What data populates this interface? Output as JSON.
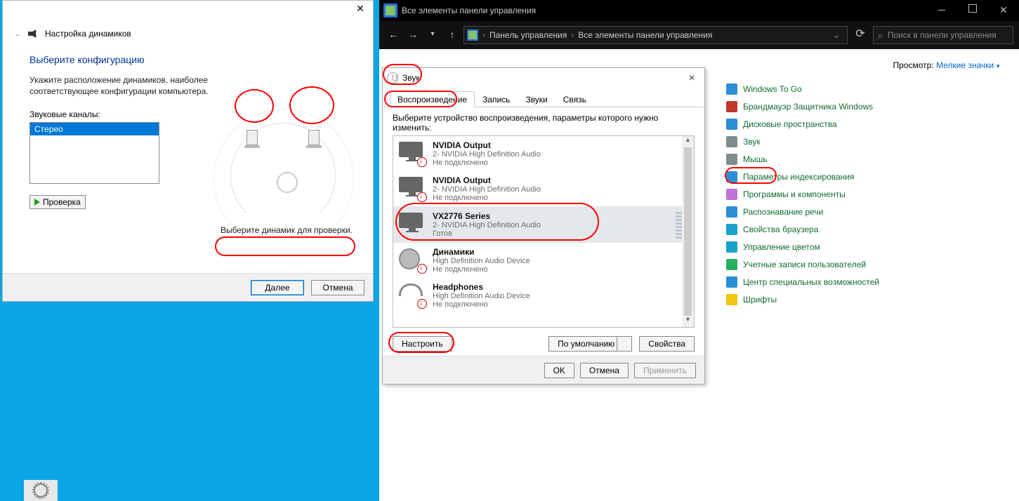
{
  "wizard": {
    "header": "Настройка динамиков",
    "title": "Выберите конфигурацию",
    "desc": "Укажите расположение динамиков, наиболее соответствующее конфигурации компьютера.",
    "channels_label": "Звуковые каналы:",
    "channels": [
      "Стерео"
    ],
    "test_btn": "Проверка",
    "hint": "Выберите динамик для проверки.",
    "next": "Далее",
    "cancel": "Отмена"
  },
  "cp": {
    "titlebar": "Все элементы панели управления",
    "crumb1": "Панель управления",
    "crumb2": "Все элементы панели управления",
    "search_placeholder": "Поиск в панели управления",
    "view_label": "Просмотр:",
    "view_value": "Мелкие значки",
    "items": [
      {
        "label": "Windows To Go",
        "color": "#2a8fd6"
      },
      {
        "label": "Брандмауэр Защитника Windows",
        "color": "#c0392b"
      },
      {
        "label": "Дисковые пространства",
        "color": "#2a8fd6"
      },
      {
        "label": "Звук",
        "color": "#7f8c8d"
      },
      {
        "label": "Мышь",
        "color": "#7f8c8d"
      },
      {
        "label": "Параметры индексирования",
        "color": "#2a8fd6"
      },
      {
        "label": "Программы и компоненты",
        "color": "#c074d4"
      },
      {
        "label": "Распознавание речи",
        "color": "#2a8fd6"
      },
      {
        "label": "Свойства браузера",
        "color": "#1aa3c8"
      },
      {
        "label": "Управление цветом",
        "color": "#1aa3c8"
      },
      {
        "label": "Учетные записи пользователей",
        "color": "#27ae60"
      },
      {
        "label": "Центр специальных возможностей",
        "color": "#2a8fd6"
      },
      {
        "label": "Шрифты",
        "color": "#f1c40f"
      }
    ]
  },
  "sound": {
    "title": "Звук",
    "tabs": [
      "Воспроизведение",
      "Запись",
      "Звуки",
      "Связь"
    ],
    "hint": "Выберите устройство воспроизведения, параметры которого нужно изменить:",
    "devices": [
      {
        "name": "NVIDIA Output",
        "sub": "2- NVIDIA High Definition Audio",
        "status": "Не подключено",
        "type": "mon",
        "badge": true
      },
      {
        "name": "NVIDIA Output",
        "sub": "2- NVIDIA High Definition Audio",
        "status": "Не подключено",
        "type": "mon",
        "badge": true
      },
      {
        "name": "VX2776 Series",
        "sub": "2- NVIDIA High Definition Audio",
        "status": "Готов",
        "type": "mon",
        "badge": false,
        "selected": true,
        "level": true
      },
      {
        "name": "Динамики",
        "sub": "High Definition Audio Device",
        "status": "Не подключено",
        "type": "spkr",
        "badge": true
      },
      {
        "name": "Headphones",
        "sub": "High Definition Audio Device",
        "status": "Не подключено",
        "type": "hp",
        "badge": true
      }
    ],
    "configure": "Настроить",
    "default": "По умолчанию",
    "properties": "Свойства",
    "ok": "OK",
    "cancel": "Отмена",
    "apply": "Применить"
  }
}
